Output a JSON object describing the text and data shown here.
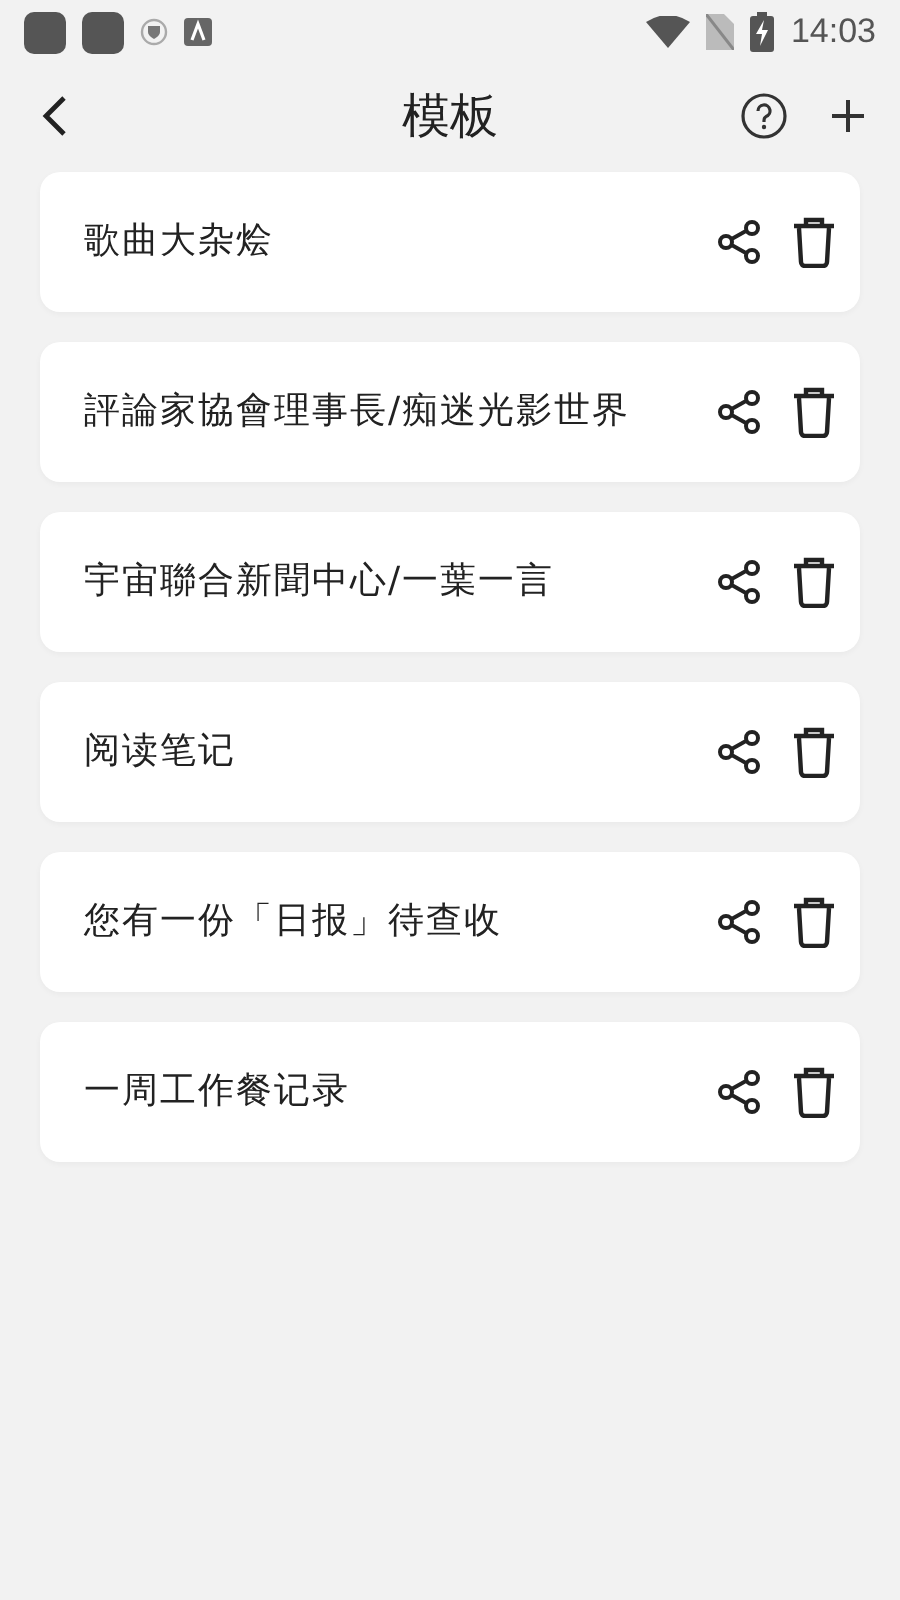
{
  "status_bar": {
    "time": "14:03"
  },
  "header": {
    "title": "模板"
  },
  "templates": [
    {
      "name": "歌曲大杂烩"
    },
    {
      "name": "評論家協會理事長/痴迷光影世界"
    },
    {
      "name": "宇宙聯合新聞中心/一葉一言"
    },
    {
      "name": "阅读笔记"
    },
    {
      "name": "您有一份「日报」待查收"
    },
    {
      "name": "一周工作餐记录"
    }
  ]
}
